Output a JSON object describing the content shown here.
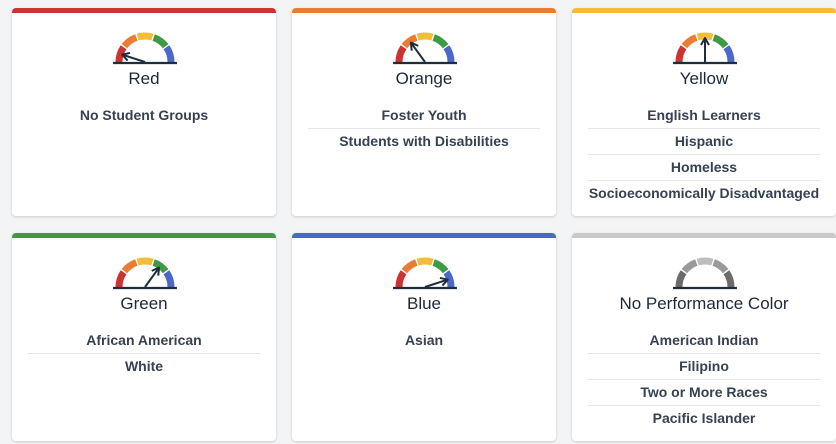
{
  "colors": {
    "red": "#cc3333",
    "orange": "#ea7d34",
    "yellow": "#f2be38",
    "green": "#3f9a48",
    "blue": "#4b67c9",
    "gray": "#c9c9c9",
    "needle": "#1f2d3d",
    "gray_gauge": [
      "#6b6b6b",
      "#9a9a9a",
      "#bdbdbd",
      "#9a9a9a",
      "#6b6b6b"
    ]
  },
  "cards": [
    {
      "title": "Red",
      "bar_color": "red",
      "gauge": "color",
      "needle_level": 0.5,
      "groups": [
        "No Student Groups"
      ]
    },
    {
      "title": "Orange",
      "bar_color": "orange",
      "gauge": "color",
      "needle_level": 1.5,
      "groups": [
        "Foster Youth",
        "Students with Disabilities"
      ]
    },
    {
      "title": "Yellow",
      "bar_color": "yellow",
      "gauge": "color",
      "needle_level": 2.5,
      "groups": [
        "English Learners",
        "Hispanic",
        "Homeless",
        "Socioeconomically Disadvantaged"
      ]
    },
    {
      "title": "Green",
      "bar_color": "green",
      "gauge": "color",
      "needle_level": 3.5,
      "groups": [
        "African American",
        "White"
      ]
    },
    {
      "title": "Blue",
      "bar_color": "blue",
      "gauge": "color",
      "needle_level": 4.5,
      "groups": [
        "Asian"
      ]
    },
    {
      "title": "No Performance Color",
      "bar_color": "gray",
      "gauge": "gray",
      "needle_level": null,
      "groups": [
        "American Indian",
        "Filipino",
        "Two or More Races",
        "Pacific Islander"
      ]
    }
  ]
}
